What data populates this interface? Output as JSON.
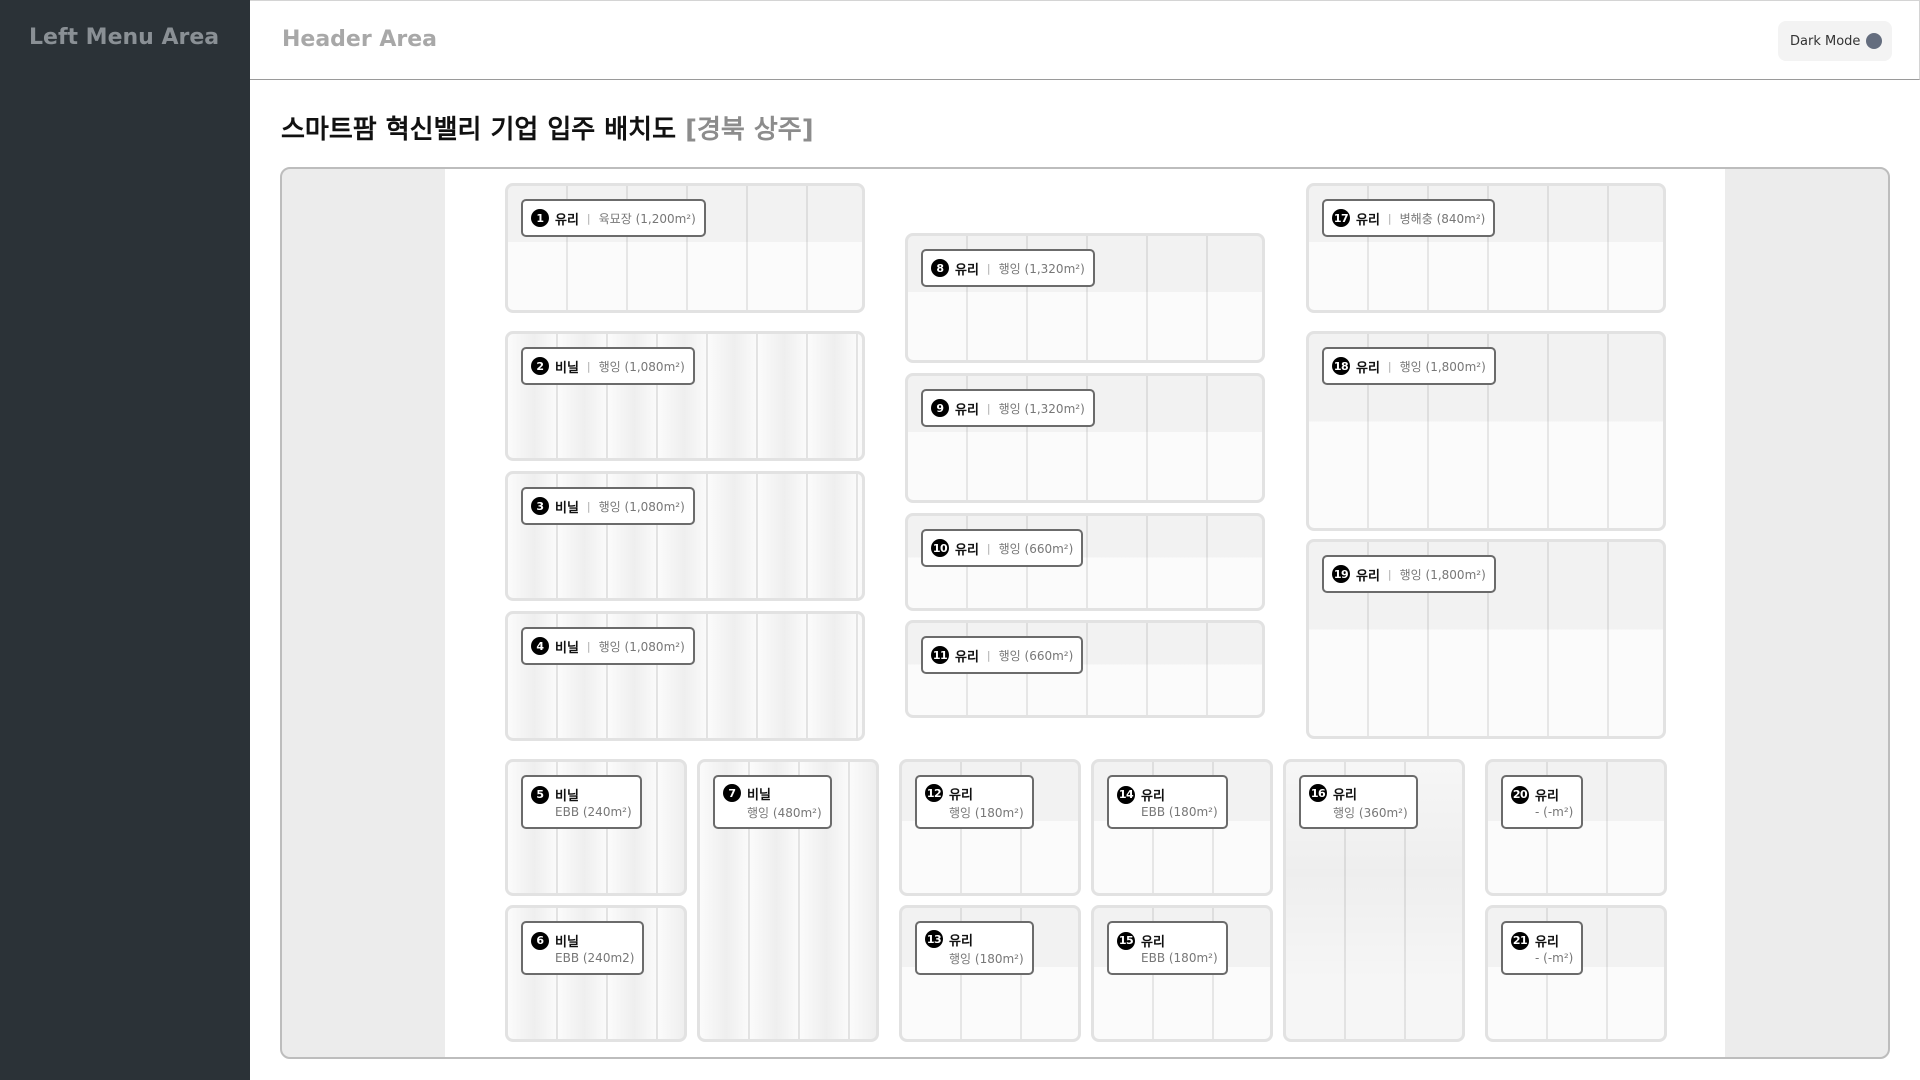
{
  "sidebar": {
    "title": "Left Menu Area"
  },
  "header": {
    "title": "Header Area",
    "dark_mode_label": "Dark Mode"
  },
  "page": {
    "title_main": "스마트팜 혁신밸리 기업 입주 배치도",
    "title_sub": "[경북 상주]"
  },
  "greenhouses": [
    {
      "num": "1",
      "type": "유리",
      "desc": "육묘장 (1,200m²)"
    },
    {
      "num": "2",
      "type": "비닐",
      "desc": "행잉 (1,080m²)"
    },
    {
      "num": "3",
      "type": "비닐",
      "desc": "행잉 (1,080m²)"
    },
    {
      "num": "4",
      "type": "비닐",
      "desc": "행잉 (1,080m²)"
    },
    {
      "num": "5",
      "type": "비닐",
      "desc": "EBB (240m²)"
    },
    {
      "num": "6",
      "type": "비닐",
      "desc": "EBB (240m2)"
    },
    {
      "num": "7",
      "type": "비닐",
      "desc": "행잉 (480m²)"
    },
    {
      "num": "8",
      "type": "유리",
      "desc": "행잉 (1,320m²)"
    },
    {
      "num": "9",
      "type": "유리",
      "desc": "행잉 (1,320m²)"
    },
    {
      "num": "10",
      "type": "유리",
      "desc": "행잉 (660m²)"
    },
    {
      "num": "11",
      "type": "유리",
      "desc": "행잉 (660m²)"
    },
    {
      "num": "12",
      "type": "유리",
      "desc": "행잉 (180m²)"
    },
    {
      "num": "13",
      "type": "유리",
      "desc": "행잉 (180m²)"
    },
    {
      "num": "14",
      "type": "유리",
      "desc": "EBB (180m²)"
    },
    {
      "num": "15",
      "type": "유리",
      "desc": "EBB (180m²)"
    },
    {
      "num": "16",
      "type": "유리",
      "desc": "행잉 (360m²)"
    },
    {
      "num": "17",
      "type": "유리",
      "desc": "병해충 (840m²)"
    },
    {
      "num": "18",
      "type": "유리",
      "desc": "행잉 (1,800m²)"
    },
    {
      "num": "19",
      "type": "유리",
      "desc": "행잉 (1,800m²)"
    },
    {
      "num": "20",
      "type": "유리",
      "desc": "- (-m²)"
    },
    {
      "num": "21",
      "type": "유리",
      "desc": "- (-m²)"
    }
  ],
  "separator": "|",
  "colors": {
    "sidebar": "#2b3237",
    "toggle_dot": "#646d7e",
    "map_bg": "#ececec"
  },
  "icons": {
    "dark_mode": "circle-toggle-icon",
    "number_badge": "filled-circle-number"
  }
}
